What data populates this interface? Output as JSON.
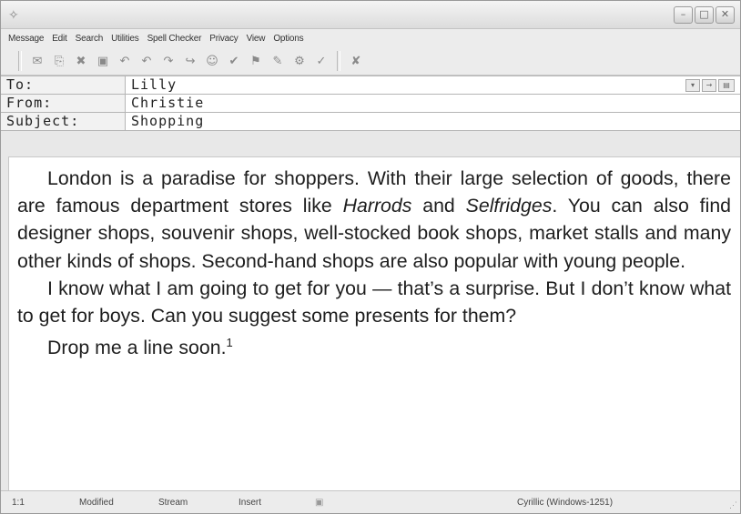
{
  "window": {
    "app_icon": "app-logo-icon",
    "controls": [
      "minimize-icon",
      "maximize-icon",
      "close-icon"
    ]
  },
  "menu": [
    "Message",
    "Edit",
    "Search",
    "Utilities",
    "Spell Checker",
    "Privacy",
    "View",
    "Options"
  ],
  "toolbar_icons": [
    "send-icon",
    "attach-icon",
    "delete-icon",
    "save-icon",
    "reply-icon",
    "reply-all-icon",
    "forward-icon",
    "redirect-icon",
    "address-book-icon",
    "check-names-icon",
    "priority-icon",
    "signature-icon",
    "encode-icon",
    "spell-check-icon",
    "exit-icon"
  ],
  "header": {
    "to_label": "To:",
    "to_value": "Lilly",
    "from_label": "From:",
    "from_value": "Christie",
    "subject_label": "Subject:",
    "subject_value": "Shopping"
  },
  "body": {
    "p1_a": "London is a paradise for shoppers. With their large selection of goods, there are famous department stores like ",
    "p1_harrods": "Harrods",
    "p1_and": " and ",
    "p1_selfridges": "Selfridges",
    "p1_b": ". You can also find designer shops, souvenir shops, well-stocked book shops, market stalls and many other kinds of shops. Second-hand shops are also popular with young people.",
    "p2": "I know what I am going to get for you — that’s a surprise. But I don’t know what to get for boys. Can you suggest some presents for them?",
    "p3": "Drop me a line soon.",
    "p3_footnote": "1"
  },
  "status": {
    "position": "1:1",
    "modified": "Modified",
    "stream": "Stream",
    "insert": "Insert",
    "encoding": "Cyrillic (Windows-1251)"
  }
}
